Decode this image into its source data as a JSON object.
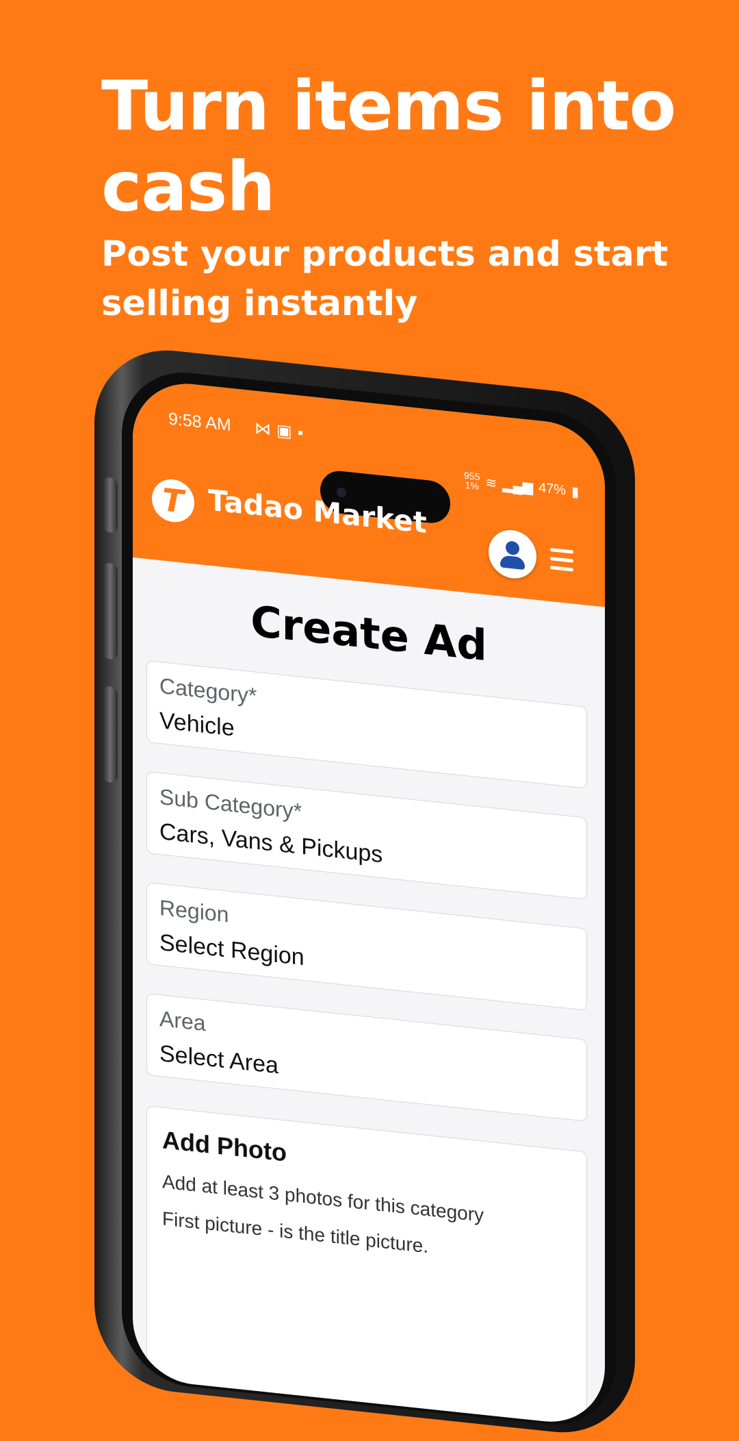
{
  "promo": {
    "headline": "Turn items into cash",
    "subheadline": "Post your products and start selling instantly"
  },
  "status_bar": {
    "time": "9:58 AM",
    "network_speed": "955",
    "network_unit": "1%",
    "battery": "47%"
  },
  "app_bar": {
    "logo_letter": "T",
    "brand_name": "Tadao Market"
  },
  "page": {
    "title": "Create Ad"
  },
  "form": {
    "fields": [
      {
        "label": "Category*",
        "value": "Vehicle"
      },
      {
        "label": "Sub Category*",
        "value": "Cars, Vans & Pickups"
      },
      {
        "label": "Region",
        "value": "Select Region"
      },
      {
        "label": "Area",
        "value": "Select Area"
      }
    ],
    "photo": {
      "title": "Add Photo",
      "line1": "Add at least 3 photos for this category",
      "line2": "First picture - is the title picture."
    }
  },
  "colors": {
    "brand_orange": "#FF7A14",
    "avatar_blue": "#1f4fa8"
  }
}
